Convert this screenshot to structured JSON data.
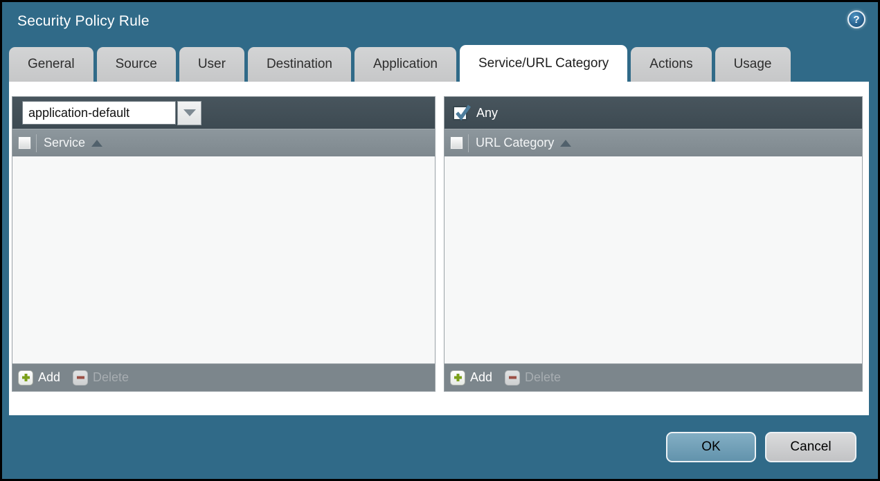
{
  "window": {
    "title": "Security Policy Rule",
    "help_glyph": "?"
  },
  "tabs": [
    {
      "label": "General"
    },
    {
      "label": "Source"
    },
    {
      "label": "User"
    },
    {
      "label": "Destination"
    },
    {
      "label": "Application"
    },
    {
      "label": "Service/URL Category"
    },
    {
      "label": "Actions"
    },
    {
      "label": "Usage"
    }
  ],
  "active_tab": "Service/URL Category",
  "service_panel": {
    "dropdown": {
      "value": "application-default"
    },
    "header": {
      "column": "Service",
      "sort": "asc"
    },
    "rows": [],
    "footer": {
      "add": "Add",
      "delete": "Delete",
      "delete_enabled": false
    }
  },
  "url_panel": {
    "any": {
      "label": "Any",
      "checked": true
    },
    "header": {
      "column": "URL Category",
      "sort": "asc"
    },
    "rows": [],
    "footer": {
      "add": "Add",
      "delete": "Delete",
      "delete_enabled": false
    }
  },
  "actions": {
    "ok": "OK",
    "cancel": "Cancel"
  },
  "colors": {
    "dialog_background": "#306a88",
    "toolbar_dark": "#3f4c54",
    "header_gray": "#848e94",
    "footer_gray": "#7c868c",
    "tab_gray": "#c8c9ca",
    "active_tab": "#ffffff",
    "ok_button": "#6f9fb8",
    "cancel_button": "#cccdce",
    "add_green": "#7ba019",
    "delete_red": "#9c4f45",
    "checkmark_blue": "#4e7d9c"
  }
}
